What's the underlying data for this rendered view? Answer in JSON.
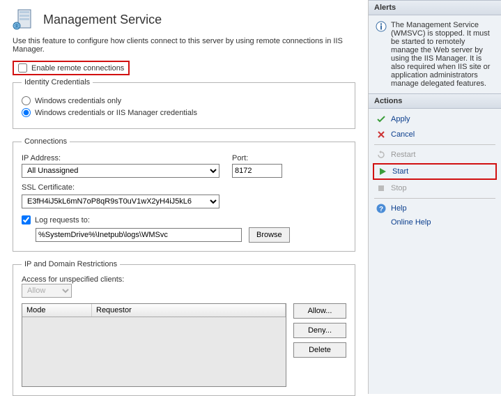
{
  "header": {
    "title": "Management Service",
    "description": "Use this feature to configure how clients connect to this server by using remote connections in IIS Manager."
  },
  "enable_remote": {
    "label": "Enable remote connections",
    "checked": false
  },
  "identity": {
    "legend": "Identity Credentials",
    "opt1": "Windows credentials only",
    "opt2": "Windows credentials or IIS Manager credentials",
    "selected": "opt2"
  },
  "connections": {
    "legend": "Connections",
    "ip_label": "IP Address:",
    "ip_value": "All Unassigned",
    "port_label": "Port:",
    "port_value": "8172",
    "ssl_label": "SSL Certificate:",
    "ssl_value": "E3fH4iJ5kL6mN7oP8qR9sT0uV1wX2yH4iJ5kL6",
    "log_label": "Log requests to:",
    "log_checked": true,
    "log_path": "%SystemDrive%\\Inetpub\\logs\\WMSvc",
    "browse": "Browse"
  },
  "restrictions": {
    "legend": "IP and Domain Restrictions",
    "access_label": "Access for unspecified clients:",
    "access_value": "Allow",
    "col_mode": "Mode",
    "col_requestor": "Requestor",
    "btn_allow": "Allow...",
    "btn_deny": "Deny...",
    "btn_delete": "Delete"
  },
  "alerts": {
    "header": "Alerts",
    "text": "The Management Service (WMSVC) is stopped. It must be started to remotely manage the Web server by using the IIS Manager. It is also required when IIS site or application administrators manage delegated features."
  },
  "actions": {
    "header": "Actions",
    "apply": "Apply",
    "cancel": "Cancel",
    "restart": "Restart",
    "start": "Start",
    "stop": "Stop",
    "help": "Help",
    "online_help": "Online Help"
  }
}
